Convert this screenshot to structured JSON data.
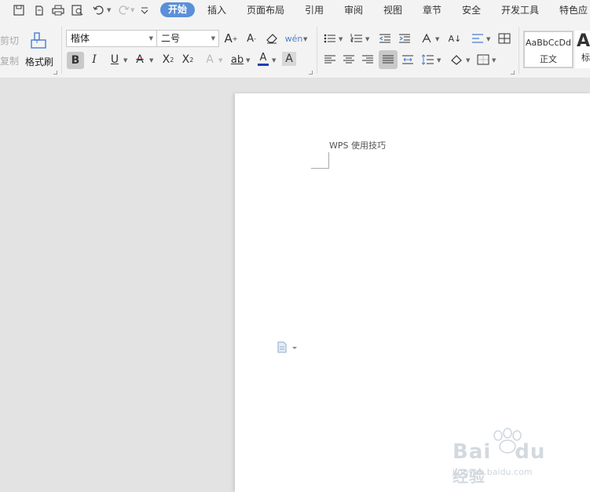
{
  "menubar": {
    "active_tab": "开始",
    "tabs": [
      "插入",
      "页面布局",
      "引用",
      "审阅",
      "视图",
      "章节",
      "安全",
      "开发工具",
      "特色应"
    ]
  },
  "ribbon": {
    "clipboard": {
      "cut": "剪切",
      "copy": "复制",
      "format_painter": "格式刷"
    },
    "font": {
      "name": "楷体",
      "size": "二号"
    },
    "styles": {
      "normal_preview": "AaBbCcDd",
      "normal_label": "正文",
      "heading_preview": "A",
      "heading_label": "标"
    }
  },
  "document": {
    "text": "WPS 使用技巧"
  },
  "watermark": {
    "brand": "Bai",
    "brand2": "du",
    "cn": "经验",
    "url": "jingyan.baidu.com"
  },
  "colors": {
    "accent": "#5b8fd9",
    "font_color_bar": "#1f3fb0",
    "page_bg": "#ffffff",
    "workspace_bg": "#e3e3e3"
  }
}
